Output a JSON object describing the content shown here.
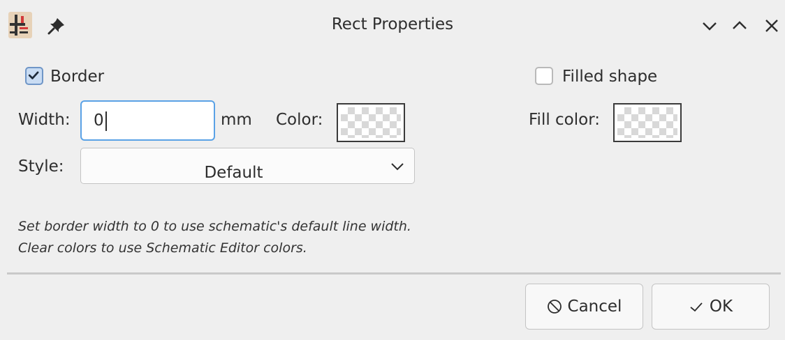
{
  "window": {
    "title": "Rect Properties",
    "icons": {
      "app": "kicad-symbol-editor-icon",
      "pin": "pin-icon",
      "minimize": "chevron-down-icon",
      "maximize": "chevron-up-icon",
      "close": "close-icon"
    }
  },
  "border": {
    "label": "Border",
    "checked": true,
    "width_label": "Width:",
    "width_value": "0",
    "width_unit": "mm",
    "color_label": "Color:",
    "style_label": "Style:",
    "style_value": "Default"
  },
  "fill": {
    "label": "Filled shape",
    "checked": false,
    "color_label": "Fill color:"
  },
  "hints": [
    "Set border width to 0 to use schematic's default line width.",
    "Clear colors to use Schematic Editor colors."
  ],
  "buttons": {
    "cancel": "Cancel",
    "ok": "OK"
  },
  "colors": {
    "accent": "#5aa2e6",
    "checkbox_checked_bg": "#c9dcf3",
    "background": "#efefef"
  }
}
